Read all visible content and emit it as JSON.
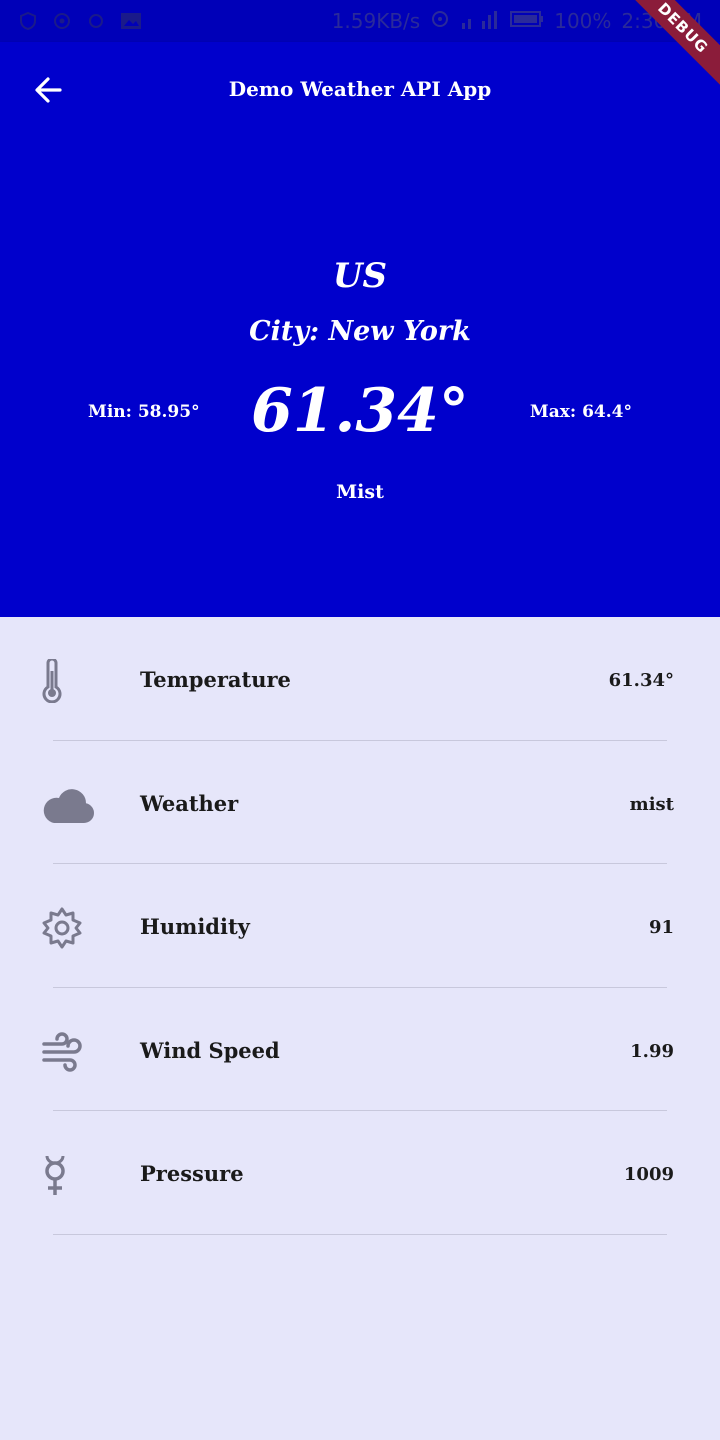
{
  "status_bar": {
    "network_speed": "1.59KB/s",
    "battery": "100%",
    "time": "2:30 PM",
    "debug_label": "DEBUG"
  },
  "app_bar": {
    "title": "Demo Weather API App",
    "back_icon": "arrow-left-icon"
  },
  "hero": {
    "country": "US",
    "city": "City: New York",
    "min": "Min: 58.95°",
    "temp": "61.34°",
    "max": "Max: 64.4°",
    "description": "Mist",
    "background_color": "#0000cc"
  },
  "details": [
    {
      "label": "Temperature",
      "value": "61.34°",
      "icon": "thermometer-icon"
    },
    {
      "label": "Weather",
      "value": "mist",
      "icon": "cloud-icon"
    },
    {
      "label": "Humidity",
      "value": "91",
      "icon": "gear-icon"
    },
    {
      "label": "Wind Speed",
      "value": "1.99",
      "icon": "wind-icon"
    },
    {
      "label": "Pressure",
      "value": "1009",
      "icon": "mercury-icon"
    }
  ]
}
